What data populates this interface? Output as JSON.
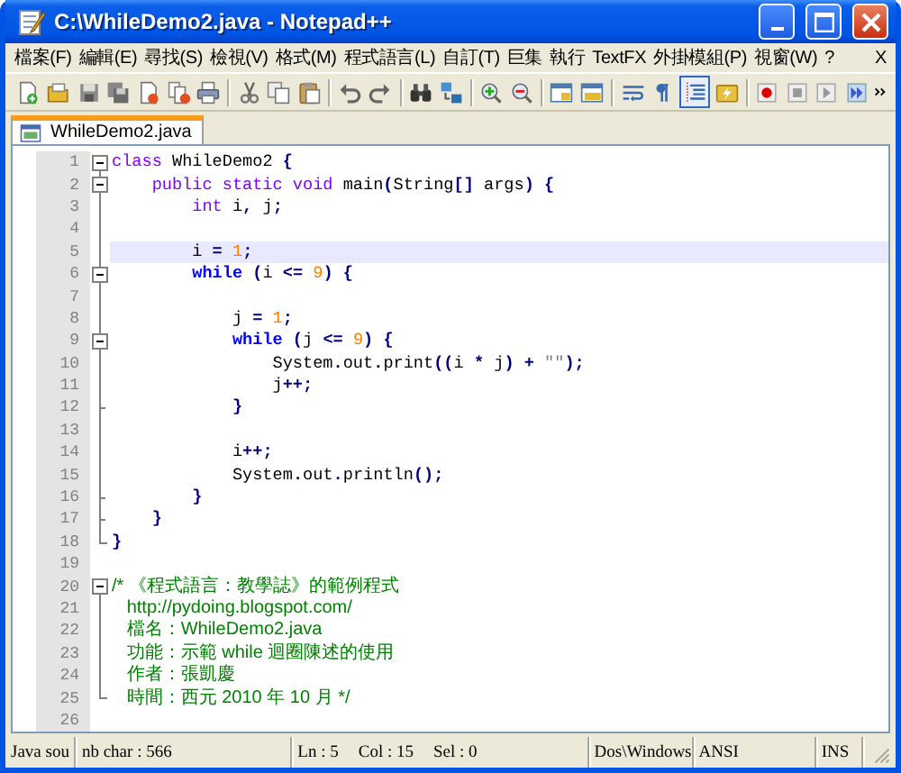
{
  "window": {
    "title": "C:\\WhileDemo2.java - Notepad++"
  },
  "menu": [
    {
      "label": "檔案(F)"
    },
    {
      "label": "編輯(E)"
    },
    {
      "label": "尋找(S)"
    },
    {
      "label": "檢視(V)"
    },
    {
      "label": "格式(M)"
    },
    {
      "label": "程式語言(L)"
    },
    {
      "label": "自訂(T)"
    },
    {
      "label": "巨集"
    },
    {
      "label": "執行"
    },
    {
      "label": "TextFX"
    },
    {
      "label": "外掛模組(P)"
    },
    {
      "label": "視窗(W)"
    },
    {
      "label": "?"
    }
  ],
  "menu_close": "X",
  "toolbar": [
    {
      "pressed": false
    },
    {
      "pressed": false
    },
    {
      "pressed": false
    },
    {
      "pressed": false
    },
    {
      "pressed": false
    },
    {
      "pressed": false
    },
    {
      "pressed": false
    },
    {
      "pressed": false
    },
    {
      "pressed": false
    },
    {
      "pressed": false
    },
    {
      "pressed": false
    },
    {
      "pressed": false
    },
    {
      "pressed": false
    },
    {
      "pressed": false
    },
    {
      "pressed": false
    },
    {
      "pressed": false
    },
    {
      "pressed": false
    },
    {
      "pressed": false
    },
    {
      "pressed": false
    },
    {
      "pressed": false
    },
    {
      "pressed": true
    },
    {
      "pressed": false
    },
    {
      "pressed": false
    },
    {
      "pressed": false
    },
    {
      "pressed": false
    },
    {
      "pressed": false
    }
  ],
  "tabs": [
    {
      "label": "WhileDemo2.java",
      "selected": true
    }
  ],
  "editor": {
    "lines": [
      {
        "number": "1",
        "kind": "start",
        "expanded": true,
        "current": false,
        "tokens": [
          {
            "text": "class",
            "kind": "type"
          },
          {
            "text": " WhileDemo2 ",
            "kind": "plain"
          },
          {
            "text": "{",
            "kind": "op"
          }
        ]
      },
      {
        "number": "2",
        "kind": "start",
        "expanded": true,
        "current": false,
        "tokens": [
          {
            "text": "    public static void",
            "kind": "type"
          },
          {
            "text": " main",
            "kind": "plain"
          },
          {
            "text": "(",
            "kind": "op"
          },
          {
            "text": "String",
            "kind": "plain"
          },
          {
            "text": "[]",
            "kind": "op"
          },
          {
            "text": " args",
            "kind": "plain"
          },
          {
            "text": ") {",
            "kind": "op"
          }
        ]
      },
      {
        "number": "3",
        "kind": "body",
        "current": false,
        "tokens": [
          {
            "text": "        int",
            "kind": "type"
          },
          {
            "text": " i",
            "kind": "plain"
          },
          {
            "text": ",",
            "kind": "op"
          },
          {
            "text": " j",
            "kind": "plain"
          },
          {
            "text": ";",
            "kind": "op"
          }
        ]
      },
      {
        "number": "4",
        "kind": "body",
        "current": false
      },
      {
        "number": "5",
        "kind": "body",
        "current": true,
        "tokens": [
          {
            "text": "        i ",
            "kind": "plain"
          },
          {
            "text": "=",
            "kind": "op"
          },
          {
            "text": " 1",
            "kind": "number"
          },
          {
            "text": ";",
            "kind": "op"
          }
        ]
      },
      {
        "number": "6",
        "kind": "start",
        "expanded": true,
        "current": false,
        "tokens": [
          {
            "text": "        while",
            "kind": "keyword"
          },
          {
            "text": " (",
            "kind": "op"
          },
          {
            "text": "i ",
            "kind": "plain"
          },
          {
            "text": "<=",
            "kind": "op"
          },
          {
            "text": " 9",
            "kind": "number"
          },
          {
            "text": ") {",
            "kind": "op"
          }
        ]
      },
      {
        "number": "7",
        "kind": "body",
        "current": false
      },
      {
        "number": "8",
        "kind": "body",
        "current": false,
        "tokens": [
          {
            "text": "            j ",
            "kind": "plain"
          },
          {
            "text": "=",
            "kind": "op"
          },
          {
            "text": " 1",
            "kind": "number"
          },
          {
            "text": ";",
            "kind": "op"
          }
        ]
      },
      {
        "number": "9",
        "kind": "start",
        "expanded": true,
        "current": false,
        "tokens": [
          {
            "text": "            while",
            "kind": "keyword"
          },
          {
            "text": " (",
            "kind": "op"
          },
          {
            "text": "j ",
            "kind": "plain"
          },
          {
            "text": "<=",
            "kind": "op"
          },
          {
            "text": " 9",
            "kind": "number"
          },
          {
            "text": ") {",
            "kind": "op"
          }
        ]
      },
      {
        "number": "10",
        "kind": "body",
        "current": false,
        "tokens": [
          {
            "text": "                System",
            "kind": "plain"
          },
          {
            "text": ".",
            "kind": "op"
          },
          {
            "text": "out",
            "kind": "plain"
          },
          {
            "text": ".",
            "kind": "op"
          },
          {
            "text": "print",
            "kind": "plain"
          },
          {
            "text": "((",
            "kind": "op"
          },
          {
            "text": "i ",
            "kind": "plain"
          },
          {
            "text": "*",
            "kind": "op"
          },
          {
            "text": " j",
            "kind": "plain"
          },
          {
            "text": ") +",
            "kind": "op"
          },
          {
            "text": " \"\"",
            "kind": "string"
          },
          {
            "text": ");",
            "kind": "op"
          }
        ]
      },
      {
        "number": "11",
        "kind": "body",
        "current": false,
        "tokens": [
          {
            "text": "                j",
            "kind": "plain"
          },
          {
            "text": "++;",
            "kind": "op"
          }
        ]
      },
      {
        "number": "12",
        "kind": "tick",
        "current": false,
        "tokens": [
          {
            "text": "            }",
            "kind": "op"
          }
        ]
      },
      {
        "number": "13",
        "kind": "body",
        "current": false
      },
      {
        "number": "14",
        "kind": "body",
        "current": false,
        "tokens": [
          {
            "text": "            i",
            "kind": "plain"
          },
          {
            "text": "++;",
            "kind": "op"
          }
        ]
      },
      {
        "number": "15",
        "kind": "body",
        "current": false,
        "tokens": [
          {
            "text": "            System",
            "kind": "plain"
          },
          {
            "text": ".",
            "kind": "op"
          },
          {
            "text": "out",
            "kind": "plain"
          },
          {
            "text": ".",
            "kind": "op"
          },
          {
            "text": "println",
            "kind": "plain"
          },
          {
            "text": "();",
            "kind": "op"
          }
        ]
      },
      {
        "number": "16",
        "kind": "tick",
        "current": false,
        "tokens": [
          {
            "text": "        }",
            "kind": "op"
          }
        ]
      },
      {
        "number": "17",
        "kind": "tick",
        "current": false,
        "tokens": [
          {
            "text": "    }",
            "kind": "op"
          }
        ]
      },
      {
        "number": "18",
        "kind": "corner",
        "current": false,
        "tokens": [
          {
            "text": "}",
            "kind": "op"
          }
        ]
      },
      {
        "number": "19",
        "kind": "none",
        "current": false
      },
      {
        "number": "20",
        "kind": "start",
        "expanded": true,
        "current": false,
        "tokens": [
          {
            "text": "/* 《程式語言：教學誌》的範例程式",
            "kind": "comment"
          }
        ]
      },
      {
        "number": "21",
        "kind": "body",
        "current": false,
        "tokens": [
          {
            "text": "   http://pydoing.blogspot.com/",
            "kind": "comment"
          }
        ]
      },
      {
        "number": "22",
        "kind": "body",
        "current": false,
        "tokens": [
          {
            "text": "   檔名：WhileDemo2.java",
            "kind": "comment"
          }
        ]
      },
      {
        "number": "23",
        "kind": "body",
        "current": false,
        "tokens": [
          {
            "text": "   功能：示範 while 迴圈陳述的使用",
            "kind": "comment"
          }
        ]
      },
      {
        "number": "24",
        "kind": "body",
        "current": false,
        "tokens": [
          {
            "text": "   作者：張凱慶",
            "kind": "comment"
          }
        ]
      },
      {
        "number": "25",
        "kind": "corner",
        "current": false,
        "tokens": [
          {
            "text": "   時間：西元 2010 年 10 月 */",
            "kind": "comment"
          }
        ]
      },
      {
        "number": "26",
        "kind": "none",
        "current": false
      }
    ]
  },
  "status_bar": {
    "file_type": "Java sou",
    "length": "nb char : 566",
    "position": [
      "Ln : 5",
      "Col : 15",
      "Sel : 0"
    ],
    "eol": "Dos\\Windows",
    "encoding": "ANSI",
    "mode": "INS"
  }
}
